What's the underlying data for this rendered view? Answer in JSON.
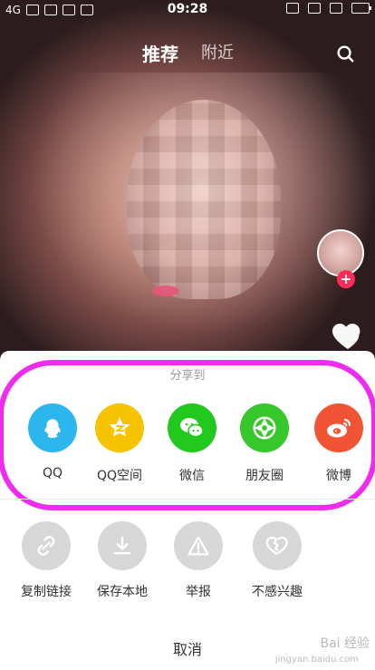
{
  "status_bar": {
    "network": "4G",
    "time": "09:28"
  },
  "top_tabs": {
    "recommended": "推荐",
    "nearby": "附近"
  },
  "share_sheet": {
    "title": "分享到",
    "share_targets": [
      {
        "label": "QQ",
        "icon": "qq-icon",
        "color": "#2bb7ee"
      },
      {
        "label": "QQ空间",
        "icon": "qzone-icon",
        "color": "#f7c300"
      },
      {
        "label": "微信",
        "icon": "wechat-icon",
        "color": "#20c91c"
      },
      {
        "label": "朋友圈",
        "icon": "moments-icon",
        "color": "#36c72a"
      },
      {
        "label": "微博",
        "icon": "weibo-icon",
        "color": "#f05434"
      }
    ],
    "actions": [
      {
        "label": "复制链接",
        "icon": "link-icon"
      },
      {
        "label": "保存本地",
        "icon": "download-icon"
      },
      {
        "label": "举报",
        "icon": "report-icon"
      },
      {
        "label": "不感兴趣",
        "icon": "broken-heart-icon"
      }
    ],
    "cancel": "取消"
  },
  "watermark": {
    "text": "Bai 经验",
    "url": "jingyan.baidu.com"
  },
  "colors": {
    "highlight_ring": "#f02bf0",
    "follow_plus": "#ff2a55"
  }
}
